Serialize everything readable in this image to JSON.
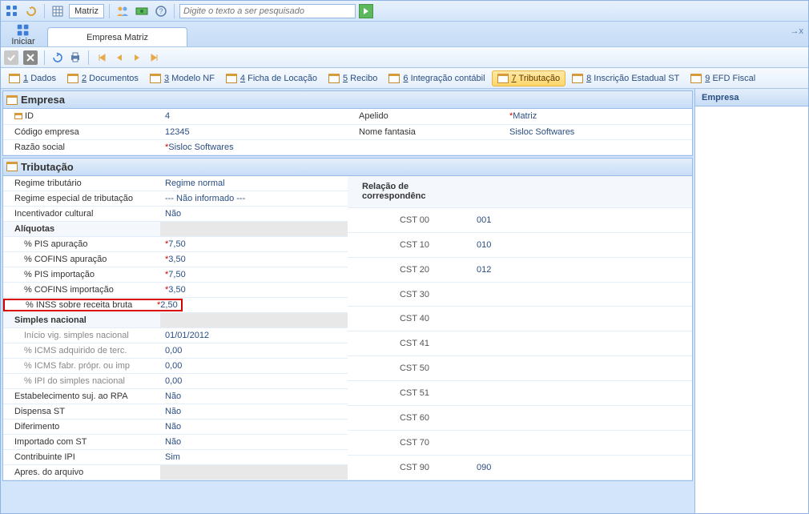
{
  "toolbar": {
    "matriz": "Matriz",
    "search_placeholder": "Digite o texto a ser pesquisado",
    "iniciar": "Iniciar",
    "tab_title": "Empresa Matriz",
    "close_tab": "→x"
  },
  "module_tabs": [
    {
      "num": "1",
      "label": "Dados"
    },
    {
      "num": "2",
      "label": "Documentos"
    },
    {
      "num": "3",
      "label": "Modelo NF"
    },
    {
      "num": "4",
      "label": "Ficha de Locação"
    },
    {
      "num": "5",
      "label": "Recibo"
    },
    {
      "num": "6",
      "label": "Integração contábil"
    },
    {
      "num": "7",
      "label": "Tributação"
    },
    {
      "num": "8",
      "label": "Inscrição Estadual ST"
    },
    {
      "num": "9",
      "label": "EFD Fiscal"
    }
  ],
  "side": {
    "title": "Empresa"
  },
  "empresa": {
    "title": "Empresa",
    "fields": {
      "id_lbl": "ID",
      "id_val": "4",
      "apelido_lbl": "Apelido",
      "apelido_val": "Matriz",
      "codigo_lbl": "Código empresa",
      "codigo_val": "12345",
      "nome_lbl": "Nome fantasia",
      "nome_val": "Sisloc Softwares",
      "razao_lbl": "Razão social",
      "razao_val": "Sisloc Softwares"
    }
  },
  "trib": {
    "title": "Tributação",
    "left": {
      "regime_lbl": "Regime tributário",
      "regime_val": "Regime normal",
      "reg_esp_lbl": "Regime especial de tributação",
      "reg_esp_val": "--- Não informado ---",
      "incent_lbl": "Incentivador cultural",
      "incent_val": "Não",
      "aliquotas_lbl": "Alíquotas",
      "pis_apur_lbl": "% PIS apuração",
      "pis_apur_val": "7,50",
      "cofins_apur_lbl": "% COFINS apuração",
      "cofins_apur_val": "3,50",
      "pis_imp_lbl": "% PIS importação",
      "pis_imp_val": "7,50",
      "cofins_imp_lbl": "% COFINS importação",
      "cofins_imp_val": "3,50",
      "inss_lbl": "% INSS sobre receita bruta",
      "inss_val": "2,50",
      "simples_lbl": "Simples nacional",
      "inicio_lbl": "Início vig. simples nacional",
      "inicio_val": "01/01/2012",
      "icms_terc_lbl": "% ICMS adquirido de terc.",
      "icms_terc_val": "0,00",
      "icms_fabr_lbl": "% ICMS fabr. própr. ou imp",
      "icms_fabr_val": "0,00",
      "ipi_simp_lbl": "% IPI do simples nacional",
      "ipi_simp_val": "0,00",
      "estab_lbl": "Estabelecimento suj. ao RPA",
      "estab_val": "Não",
      "disp_st_lbl": "Dispensa ST",
      "disp_st_val": "Não",
      "difer_lbl": "Diferimento",
      "difer_val": "Não",
      "imp_st_lbl": "Importado com ST",
      "imp_st_val": "Não",
      "contr_ipi_lbl": "Contribuinte IPI",
      "contr_ipi_val": "Sim",
      "apres_lbl": "Apres. do arquivo",
      "apres_val": ""
    },
    "right": {
      "header": "Relação de correspondênc",
      "rows": [
        {
          "lbl": "CST 00",
          "val": "001"
        },
        {
          "lbl": "CST 10",
          "val": "010"
        },
        {
          "lbl": "CST 20",
          "val": "012"
        },
        {
          "lbl": "CST 30",
          "val": ""
        },
        {
          "lbl": "CST 40",
          "val": ""
        },
        {
          "lbl": "CST 41",
          "val": ""
        },
        {
          "lbl": "CST 50",
          "val": ""
        },
        {
          "lbl": "CST 51",
          "val": ""
        },
        {
          "lbl": "CST 60",
          "val": ""
        },
        {
          "lbl": "CST 70",
          "val": ""
        },
        {
          "lbl": "CST 90",
          "val": "090"
        }
      ]
    }
  }
}
